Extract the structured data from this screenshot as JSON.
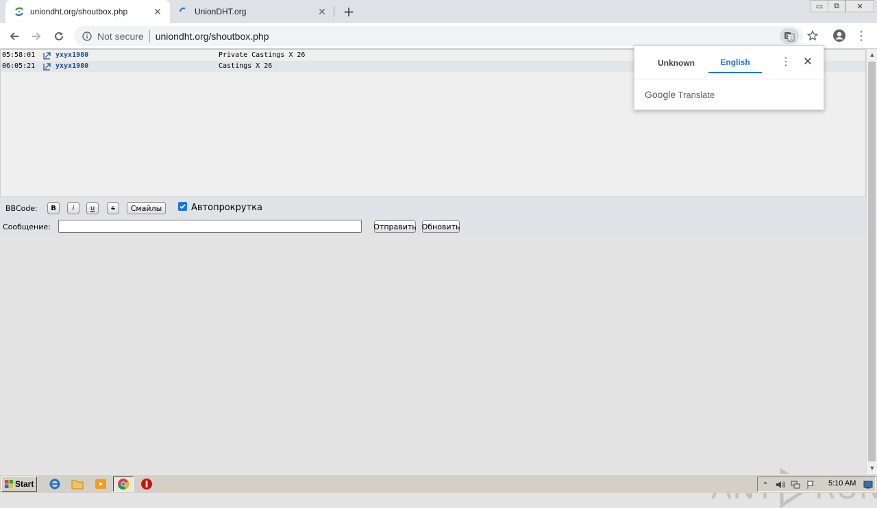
{
  "browser": {
    "tabs": [
      {
        "title": "uniondht.org/shoutbox.php",
        "active": true
      },
      {
        "title": "UnionDHT.org",
        "active": false,
        "loading": true
      }
    ],
    "new_tab_label": "+",
    "address_bar": {
      "security_label": "Not secure",
      "url": "uniondht.org/shoutbox.php"
    },
    "window_controls": {
      "minimize": "▭",
      "restore": "⧉",
      "close": "✕"
    }
  },
  "translate_popup": {
    "source_language": "Unknown",
    "target_language": "English",
    "brand_google": "Google",
    "brand_translate": "Translate"
  },
  "shoutbox": {
    "messages": [
      {
        "time": "05:58:01",
        "user": "yxyx1980",
        "text": "Private Castings X 26"
      },
      {
        "time": "06:05:21",
        "user": "yxyx1980",
        "text": "Castings X 26"
      }
    ],
    "controls": {
      "bbcode_label": "BBCode:",
      "bold_label": "B",
      "italic_label": "i",
      "underline_label": "u",
      "strike_label": "s",
      "smiles_label": "Смайлы",
      "autoscroll_label": "Автопрокрутка",
      "autoscroll_checked": true,
      "message_label": "Сообщение:",
      "message_value": "",
      "send_label": "Отправить",
      "refresh_label": "Обновить"
    }
  },
  "watermark": {
    "left": "ANY",
    "right": "RUN"
  },
  "taskbar": {
    "start_label": "Start",
    "clock": "5:10 AM"
  },
  "colors": {
    "accent": "#1a73e8",
    "username": "#1a4e8a"
  }
}
